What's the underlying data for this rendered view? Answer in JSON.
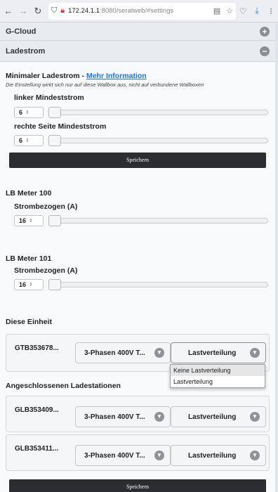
{
  "browser": {
    "url_host": "172.24.1.1",
    "url_rest": ":8080/seralweb/#settings"
  },
  "gcloud": {
    "title": "G-Cloud",
    "toggle": "+"
  },
  "ladestrom": {
    "title": "Ladestrom",
    "toggle": "−",
    "min_title": "Minimaler Ladestrom  - ",
    "more_info": "Mehr Information",
    "note": "Die Einstellung wirkt sich nur auf diese Wallbox aus, nicht auf verbundene Wallboxen",
    "left_label": "linker Mindeststrom",
    "left_value": "6",
    "right_label": "rechte Seite Mindeststrom",
    "right_value": "6",
    "save": "Speichern"
  },
  "meter100": {
    "title": "LB Meter 100",
    "label": "Strombezogen (A)",
    "value": "16"
  },
  "meter101": {
    "title": "LB Meter 101",
    "label": "Strombezogen (A)",
    "value": "16"
  },
  "unit": {
    "title": "Diese Einheit",
    "device": "GTB353678...",
    "phase": "3-Phasen 400V T...",
    "mode": "Lastverteilung",
    "dropdown_options": [
      "Keine Lastverteilung",
      "Lastverteilung"
    ]
  },
  "stations": {
    "title": "Angeschlossenen Ladestationen",
    "items": [
      {
        "device": "GLB353409...",
        "phase": "3-Phasen 400V T...",
        "mode": "Lastverteilung"
      },
      {
        "device": "GLB353411...",
        "phase": "3-Phasen 400V T...",
        "mode": "Lastverteilung"
      }
    ]
  },
  "footer_save": "Speichern"
}
